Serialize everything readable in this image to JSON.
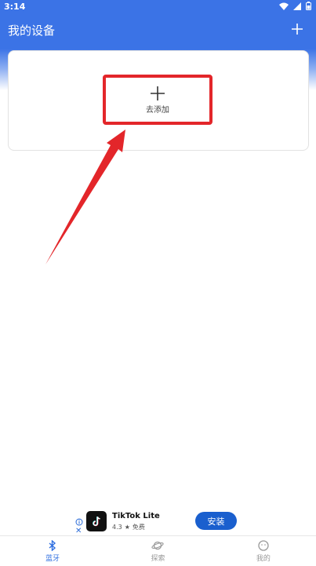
{
  "status_bar": {
    "time": "3:14"
  },
  "app_bar": {
    "title": "我的设备"
  },
  "device_card": {
    "add_label": "去添加"
  },
  "ad": {
    "app_name": "TikTok Lite",
    "rating": "4.3",
    "star": "★",
    "price": "免费",
    "install_label": "安装"
  },
  "bottom_nav": {
    "items": [
      {
        "label": "蓝牙",
        "icon": "bluetooth-icon",
        "active": true
      },
      {
        "label": "探索",
        "icon": "planet-icon",
        "active": false
      },
      {
        "label": "我的",
        "icon": "face-icon",
        "active": false
      }
    ]
  },
  "colors": {
    "primary": "#3b73e6",
    "highlight_border": "#e3262a",
    "install_button": "#1a5fce",
    "nav_active": "#2f6fe0"
  }
}
